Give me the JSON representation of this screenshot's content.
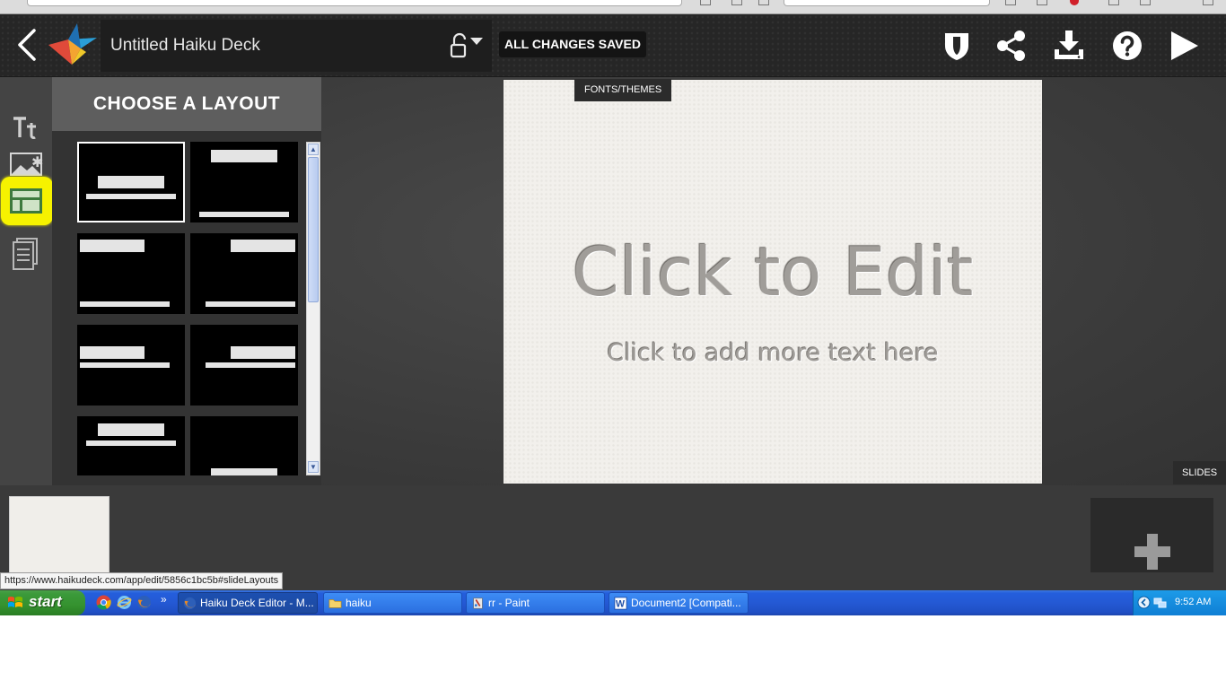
{
  "header": {
    "deck_title": "Untitled Haiku Deck",
    "save_status": "ALL CHANGES SAVED",
    "icons": [
      "back-icon",
      "haiku-deck-logo",
      "lock-icon",
      "shield-icon",
      "share-icon",
      "download-icon",
      "help-icon",
      "play-icon"
    ]
  },
  "tools": [
    "text-tool-icon",
    "image-tool-icon",
    "layout-tool-icon",
    "notes-tool-icon"
  ],
  "layout_panel": {
    "title": "CHOOSE A LAYOUT",
    "selected_index": 0,
    "layout_count": 8
  },
  "editor": {
    "fonts_tab": "FONTS/THEMES",
    "slide_title": "Click to Edit",
    "slide_subtitle": "Click to add more text here",
    "slides_tab": "SLIDES"
  },
  "status_bar": {
    "url": "https://www.haikudeck.com/app/edit/5856c1bc5b#slideLayouts"
  },
  "taskbar": {
    "start_label": "start",
    "quick_launch": [
      "chrome-icon",
      "ie-icon",
      "firefox-icon"
    ],
    "more": "»",
    "tasks": [
      {
        "label": "Haiku Deck Editor - M...",
        "icon": "firefox-icon",
        "active": true
      },
      {
        "label": "haiku",
        "icon": "folder-icon",
        "active": false
      },
      {
        "label": "rr - Paint",
        "icon": "paint-icon",
        "active": false
      },
      {
        "label": "Document2 [Compati...",
        "icon": "word-icon",
        "active": false
      }
    ],
    "clock": "9:52 AM"
  },
  "colors": {
    "header_bg": "#262626",
    "panel_bg": "#333333",
    "highlight": "#f6f200",
    "taskbar_blue": "#245edc",
    "start_green": "#3b9a3a"
  }
}
